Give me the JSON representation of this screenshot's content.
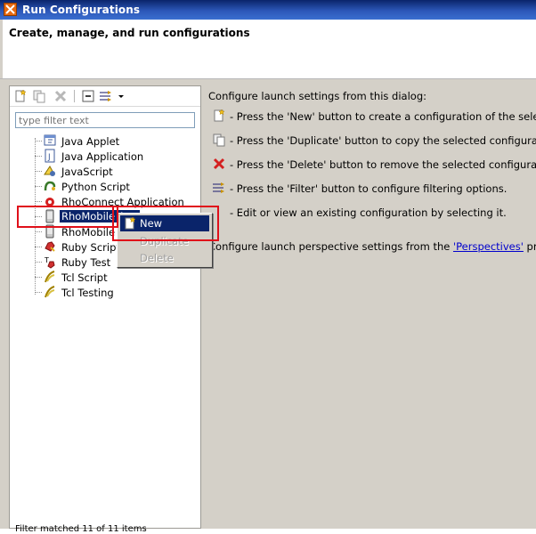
{
  "window": {
    "title": "Run Configurations"
  },
  "header": {
    "heading": "Create, manage, and run configurations"
  },
  "toolbar": {
    "new_icon": "new-config-icon",
    "duplicate_icon": "duplicate-icon",
    "delete_icon": "delete-icon",
    "collapse_icon": "collapse-all-icon",
    "filter_icon": "filter-icon",
    "menu_icon": "view-menu-icon"
  },
  "filter": {
    "placeholder": "type filter text"
  },
  "tree": {
    "items": [
      {
        "label": "Java Applet",
        "icon": "java-applet-icon"
      },
      {
        "label": "Java Application",
        "icon": "java-application-icon"
      },
      {
        "label": "JavaScript",
        "icon": "javascript-icon"
      },
      {
        "label": "Python Script",
        "icon": "python-script-icon"
      },
      {
        "label": "RhoConnect Application",
        "icon": "rhoconnect-icon"
      },
      {
        "label": "RhoMobile App",
        "icon": "rhomobile-icon"
      },
      {
        "label": "RhoMobile spe",
        "icon": "rhomobile-spec-icon"
      },
      {
        "label": "Ruby Script",
        "icon": "ruby-script-icon"
      },
      {
        "label": "Ruby Test",
        "icon": "ruby-test-icon"
      },
      {
        "label": "Tcl Script",
        "icon": "tcl-script-icon"
      },
      {
        "label": "Tcl Testing",
        "icon": "tcl-testing-icon"
      }
    ],
    "bottom_text": "Filter matched 11 of 11 items"
  },
  "right": {
    "intro": "Configure launch settings from this dialog:",
    "rows": [
      {
        "text": "- Press the 'New' button to create a configuration of the selected type.",
        "icon": "new-config-icon"
      },
      {
        "text": "- Press the 'Duplicate' button to copy the selected configuration.",
        "icon": "duplicate-icon"
      },
      {
        "text": "- Press the 'Delete' button to remove the selected configuration.",
        "icon": "delete-icon"
      },
      {
        "text": "- Press the 'Filter' button to configure filtering options.",
        "icon": "filter-icon"
      },
      {
        "text": "- Edit or view an existing configuration by selecting it.",
        "icon": ""
      }
    ],
    "persp_prefix": "Configure launch perspective settings from the ",
    "persp_link": "'Perspectives'",
    "persp_suffix": " preference page."
  },
  "context_menu": {
    "items": [
      {
        "label": "New",
        "enabled": true,
        "highlighted": true
      },
      {
        "label": "Duplicate",
        "enabled": false
      },
      {
        "label": "Delete",
        "enabled": false
      }
    ]
  },
  "colors": {
    "titlebar": "#0a246a",
    "selection": "#0a246a",
    "annotation": "#e0101a",
    "panel": "#d4d0c8"
  }
}
